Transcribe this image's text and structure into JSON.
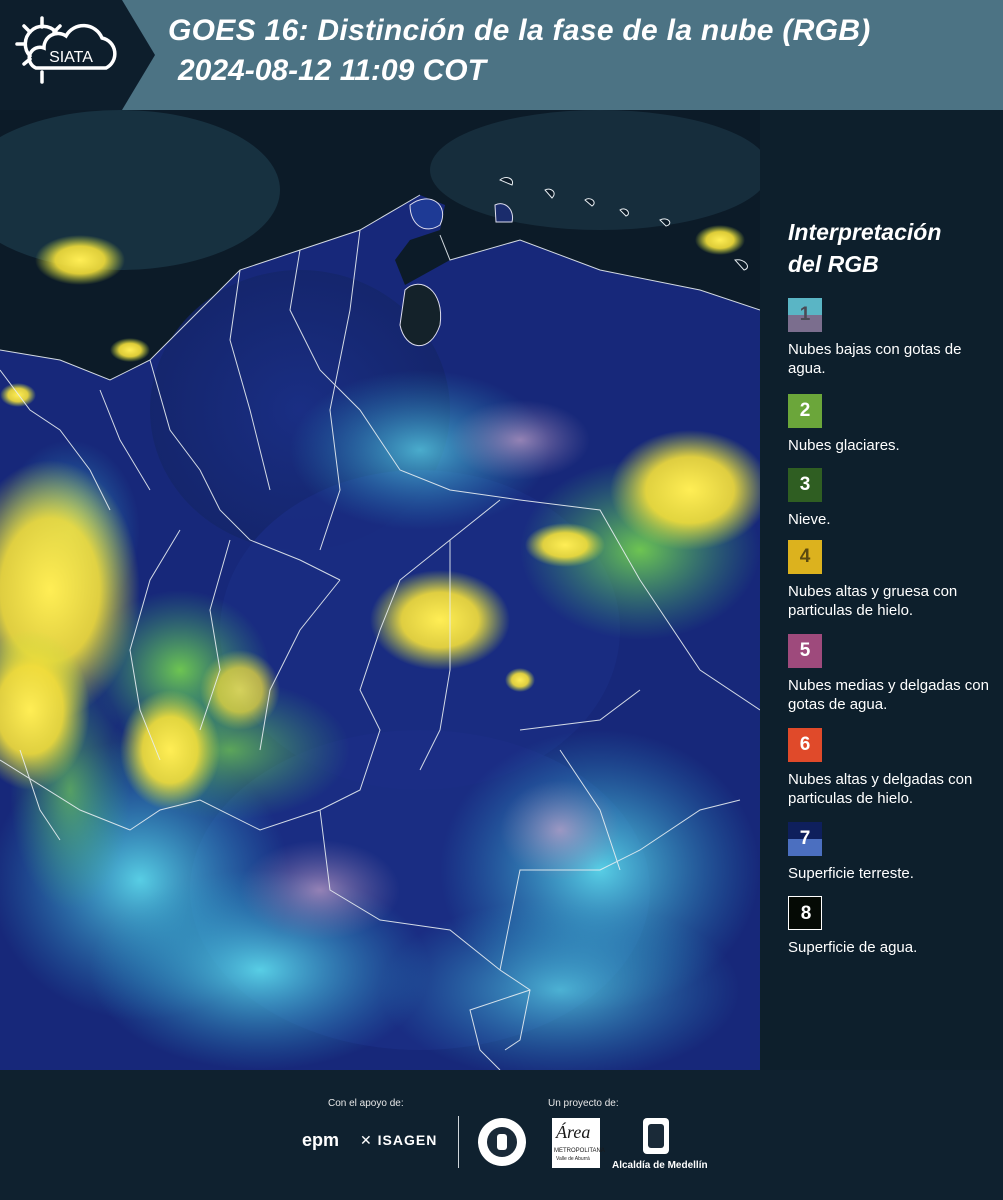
{
  "header": {
    "logo_text": "SIATA",
    "title": "GOES 16: Distinción de la fase de la nube (RGB)",
    "timestamp": "2024-08-12 11:09 COT"
  },
  "legend": {
    "title_line1": "Interpretación",
    "title_line2": "del RGB",
    "items": [
      {
        "num": "1",
        "label": "Nubes bajas con gotas de agua.",
        "colors": [
          "#5ab5c5",
          "#7b6e8e"
        ],
        "num_color": "#4a4a55"
      },
      {
        "num": "2",
        "label": "Nubes glaciares.",
        "colors": [
          "#6ba63a"
        ],
        "num_color": "#ffffff"
      },
      {
        "num": "3",
        "label": "Nieve.",
        "colors": [
          "#2f5e22"
        ],
        "num_color": "#ffffff"
      },
      {
        "num": "4",
        "label": "Nubes altas y gruesa con particulas de hielo.",
        "colors": [
          "#dcb21e"
        ],
        "num_color": "#5a4a10"
      },
      {
        "num": "5",
        "label": "Nubes medias y delgadas con gotas de agua.",
        "colors": [
          "#9e4a7c"
        ],
        "num_color": "#ffffff"
      },
      {
        "num": "6",
        "label": "Nubes altas y delgadas con particulas de hielo.",
        "colors": [
          "#e04a2a"
        ],
        "num_color": "#ffffff"
      },
      {
        "num": "7",
        "label": "Superficie terreste.",
        "colors": [
          "#0e1f5c",
          "#4b6fc0"
        ],
        "num_color": "#ffffff"
      },
      {
        "num": "8",
        "label": "Superficie de agua.",
        "colors": [
          "#050a05"
        ],
        "num_color": "#ffffff"
      }
    ]
  },
  "footer": {
    "support_label": "Con el apoyo de:",
    "project_label": "Un proyecto de:",
    "sponsor_epm": "epm",
    "sponsor_isagen": "ISAGEN",
    "area_metro": "Área",
    "area_metro_sub": "METROPOLITANA",
    "area_metro_sub2": "Valle de Aburrá",
    "alcaldia": "Alcaldía de Medellín"
  }
}
